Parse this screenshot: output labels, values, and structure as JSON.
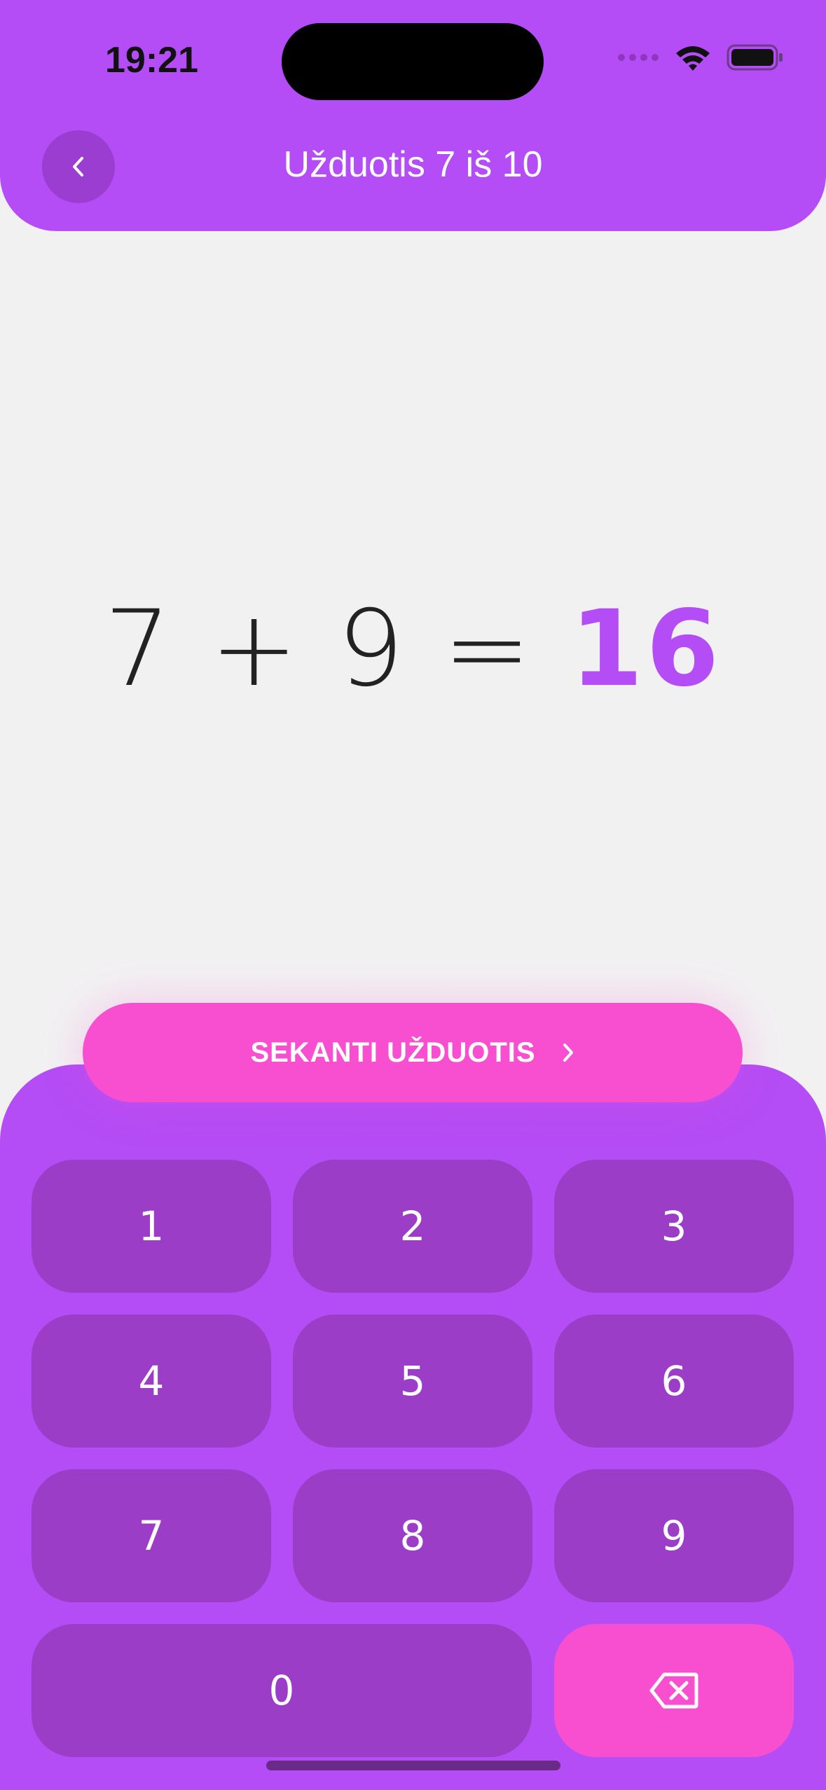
{
  "status": {
    "time": "19:21"
  },
  "header": {
    "title": "Užduotis 7 iš 10"
  },
  "equation": {
    "left": "7",
    "op": "+",
    "right": "9",
    "eq": "=",
    "answer": "16"
  },
  "next_button": {
    "label": "SEKANTI UŽDUOTIS"
  },
  "keypad": {
    "k1": "1",
    "k2": "2",
    "k3": "3",
    "k4": "4",
    "k5": "5",
    "k6": "6",
    "k7": "7",
    "k8": "8",
    "k9": "9",
    "k0": "0"
  },
  "colors": {
    "accent": "#B44DF5",
    "key": "#9B3DC6",
    "pink": "#F84FD0",
    "background": "#F2F1F2"
  },
  "icons": [
    "back-chevron-icon",
    "wifi-icon",
    "battery-icon",
    "chevron-right-icon",
    "backspace-icon"
  ]
}
